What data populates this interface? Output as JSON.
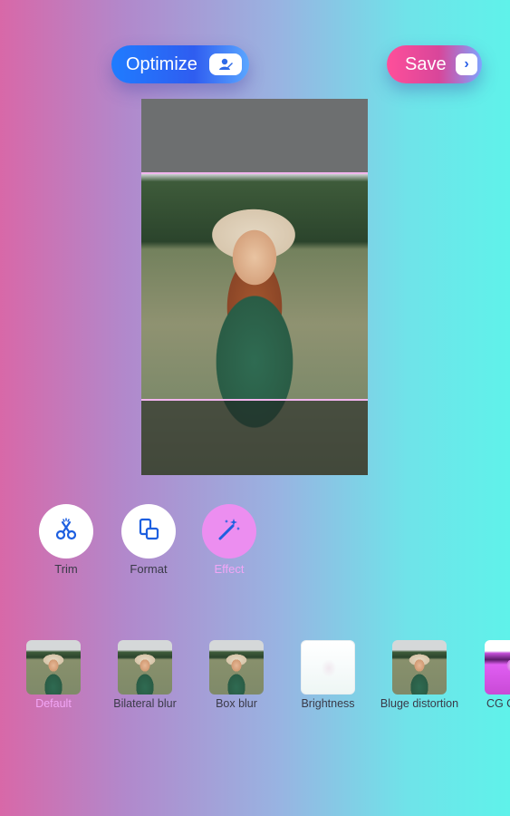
{
  "header": {
    "optimize_label": "Optimize",
    "save_label": "Save",
    "optimize_icon": "person-edit-icon",
    "save_icon": "chevron-right-icon"
  },
  "tools": [
    {
      "label": "Trim",
      "icon": "scissors-icon"
    },
    {
      "label": "Format",
      "icon": "format-icon"
    },
    {
      "label": "Effect",
      "icon": "magic-wand-icon",
      "selected": true
    }
  ],
  "effects": [
    {
      "label": "Default",
      "selected": true
    },
    {
      "label": "Bilateral blur"
    },
    {
      "label": "Box blur"
    },
    {
      "label": "Brightness"
    },
    {
      "label": "Bluge distortion"
    },
    {
      "label": "CG Color"
    }
  ],
  "colors": {
    "accent_selected": "#f2a6f6",
    "optimize_blue": "#2f5df0",
    "save_pink": "#ff4f9a",
    "crop_line": "#f2b5ee"
  }
}
